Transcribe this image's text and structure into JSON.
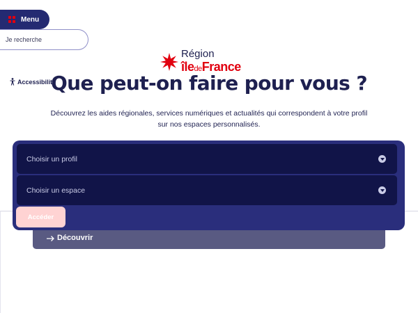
{
  "header": {
    "menu_label": "Menu",
    "menu_icon": "grid-icon",
    "search_placeholder": "Je recherche",
    "accessibility_label": "Accessibilité",
    "accessibility_icon": "accessibility-person-icon"
  },
  "logo": {
    "line1": "Région",
    "ile": "île",
    "de": "de",
    "france": "France",
    "brand_red": "#e1000f",
    "brand_navy": "#1e2050"
  },
  "main": {
    "title": "Que peut-on faire pour vous ?",
    "intro_line1": "Découvrez les aides régionales, services numériques et actualités qui correspondent à votre profil",
    "intro_line2": "sur nos espaces personnalisés."
  },
  "form": {
    "profile_select": "Choisir un profil",
    "space_select": "Choisir un espace",
    "submit_label": "Accéder"
  },
  "discover": {
    "label": "Découvrir",
    "icon": "arrow-right-icon"
  },
  "colors": {
    "panel": "#2a2e7c",
    "select_bg": "#111448",
    "button_disabled": "#ffd3d3",
    "discover_bg": "#595a82"
  }
}
